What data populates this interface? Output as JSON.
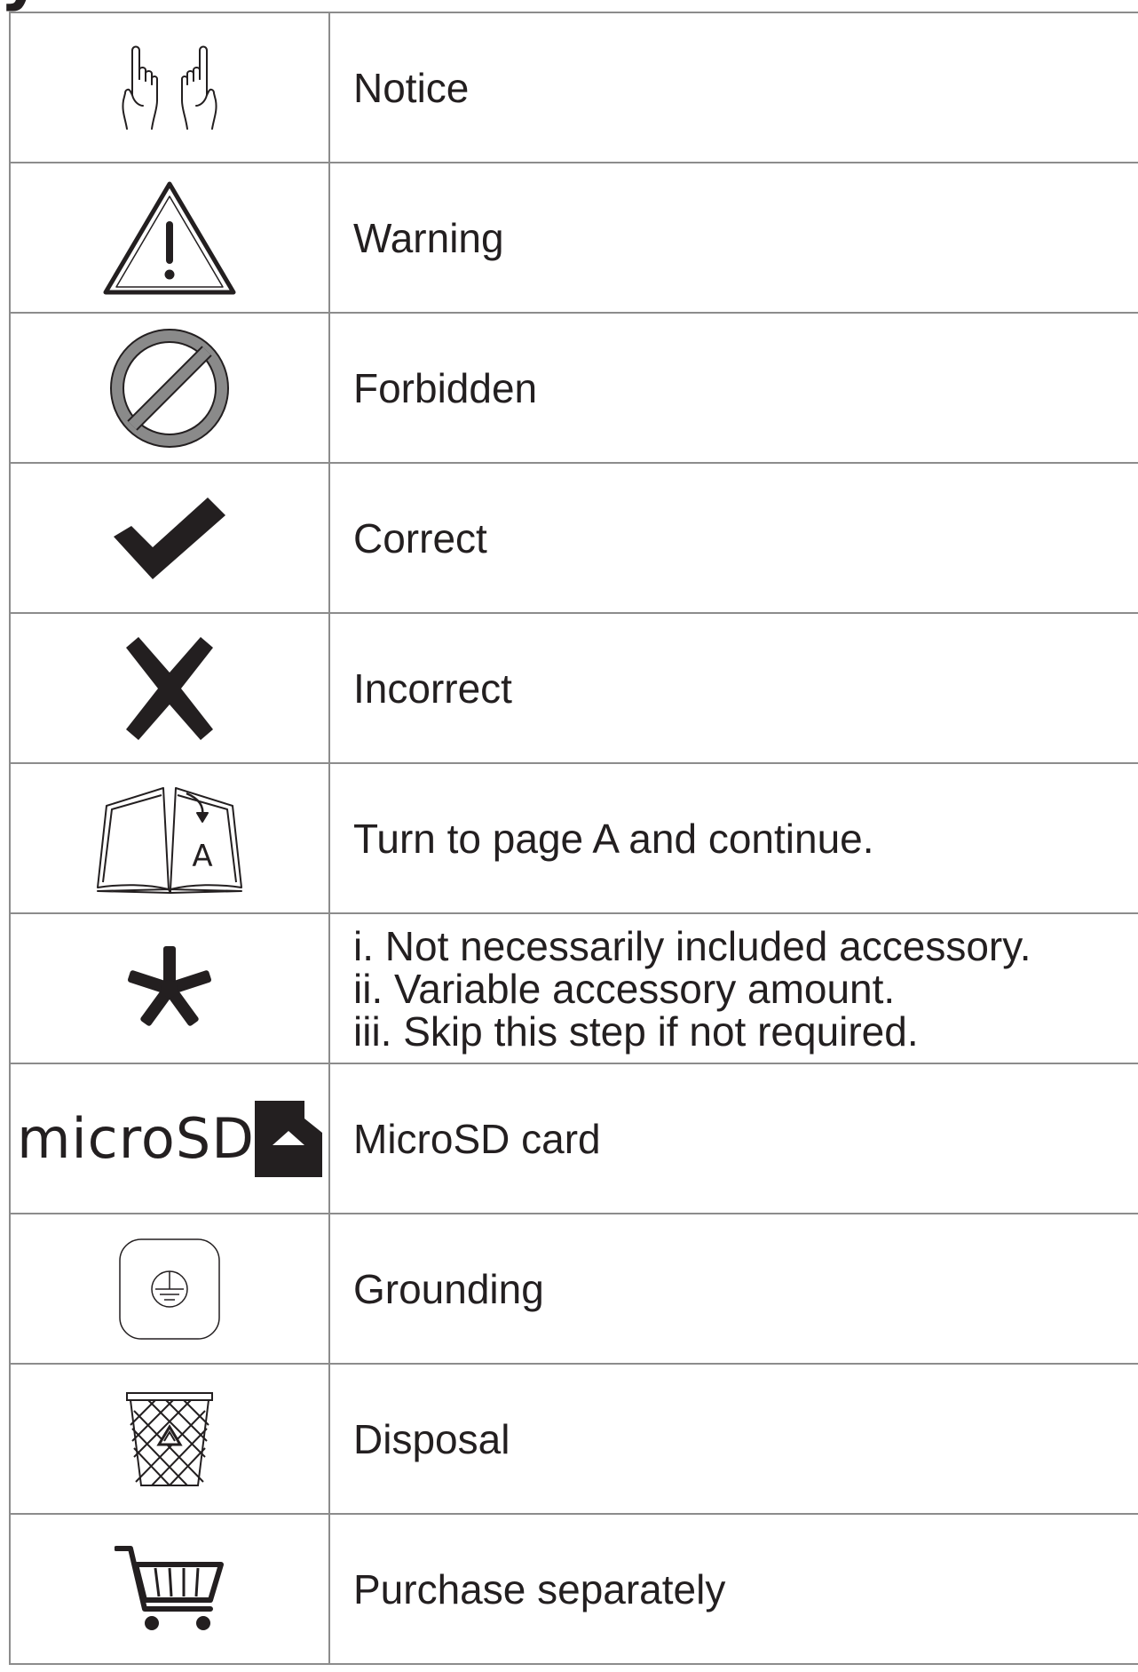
{
  "colors": {
    "ink": "#231f20",
    "border": "#8c8c8c",
    "forbidden_gray": "#8a8a8a"
  },
  "rows": [
    {
      "icon": "notice-hands-icon",
      "lines": [
        "Notice"
      ]
    },
    {
      "icon": "warning-triangle-icon",
      "lines": [
        "Warning"
      ]
    },
    {
      "icon": "forbidden-circle-icon",
      "lines": [
        "Forbidden"
      ]
    },
    {
      "icon": "checkmark-icon",
      "lines": [
        "Correct"
      ]
    },
    {
      "icon": "cross-icon",
      "lines": [
        "Incorrect"
      ]
    },
    {
      "icon": "open-book-icon",
      "icon_label": "A",
      "lines": [
        "Turn to page A and continue."
      ]
    },
    {
      "icon": "asterisk-icon",
      "lines": [
        "i. Not necessarily included accessory.",
        "ii. Variable accessory amount.",
        "iii. Skip this step if not required."
      ]
    },
    {
      "icon": "microsd-logo-icon",
      "icon_label": "microSD",
      "lines": [
        "MicroSD card"
      ]
    },
    {
      "icon": "grounding-icon",
      "lines": [
        "Grounding"
      ]
    },
    {
      "icon": "recycle-bin-icon",
      "lines": [
        "Disposal"
      ]
    },
    {
      "icon": "shopping-cart-icon",
      "lines": [
        "Purchase separately"
      ]
    }
  ]
}
